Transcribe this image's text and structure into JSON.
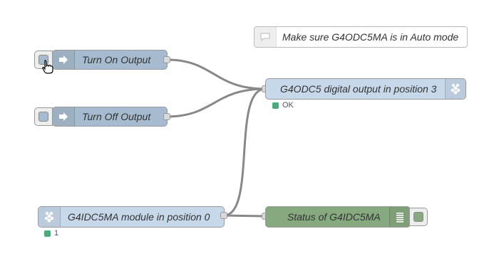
{
  "comment": {
    "text": "Make sure G4ODC5MA is in Auto mode",
    "icon": "comment-icon"
  },
  "nodes": {
    "turn_on": {
      "label": "Turn On Output",
      "icon": "inject-arrow-icon"
    },
    "turn_off": {
      "label": "Turn Off Output",
      "icon": "inject-arrow-icon"
    },
    "digital_output": {
      "label": "G4ODC5 digital output in position 3",
      "icon": "raspberry-pi-icon"
    },
    "input_module": {
      "label": "G4IDC5MA module in position 0",
      "icon": "raspberry-pi-icon"
    },
    "status_debug": {
      "label": "Status of G4IDC5MA",
      "icon": "debug-list-icon"
    }
  },
  "statuses": {
    "digital_output": {
      "text": "OK",
      "color": "#4caa7c"
    },
    "input_module": {
      "text": "1",
      "color": "#4caa7c"
    }
  },
  "colors": {
    "inject": "#a6bbcf",
    "rpi": "#c7d8ea",
    "debug": "#87a980",
    "wire": "#888888"
  }
}
